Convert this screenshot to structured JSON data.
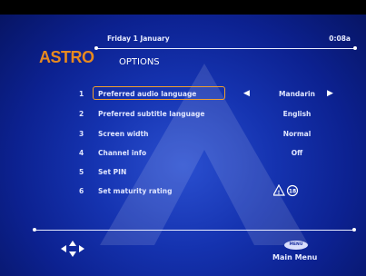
{
  "header": {
    "logo": "ASTRO",
    "date": "Friday 1 January",
    "time": "0:08a",
    "title": "OPTIONS"
  },
  "menu": {
    "items": [
      {
        "num": "1",
        "label": "Preferred audio language",
        "value": "Mandarin",
        "selected": true
      },
      {
        "num": "2",
        "label": "Preferred subtitle language",
        "value": "English"
      },
      {
        "num": "3",
        "label": "Screen width",
        "value": "Normal"
      },
      {
        "num": "4",
        "label": "Channel info",
        "value": "Off"
      },
      {
        "num": "5",
        "label": "Set PIN",
        "value": ""
      },
      {
        "num": "6",
        "label": "Set maturity rating",
        "value": ""
      }
    ],
    "rating_badge": "18"
  },
  "footer": {
    "menu_button_label": "MENU",
    "menu_caption": "Main Menu"
  },
  "colors": {
    "accent": "#e88a1f",
    "background": "#1533b0",
    "text": "#e0e6ff"
  }
}
